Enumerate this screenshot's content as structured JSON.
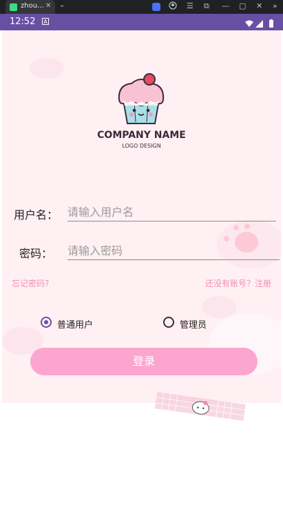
{
  "host_window": {
    "tab_title": "zhou…",
    "tab_close": "✕",
    "new_tab_chevron": "⌄",
    "controls": [
      "☰",
      "⧉",
      "—",
      "▢",
      "✕",
      "»"
    ]
  },
  "status_bar": {
    "time": "12:52",
    "notif_letter": "A",
    "color": "#6750a4"
  },
  "app": {
    "logo": {
      "company": "COMPANY NAME",
      "subtitle": "LOGO DESIGN"
    },
    "form": {
      "username_label": "用户名：",
      "username_placeholder": "请输入用户名",
      "password_label": "密码：",
      "password_placeholder": "请输入密码"
    },
    "links": {
      "forgot": "忘记密码?",
      "register": "还没有账号？注册"
    },
    "roles": [
      {
        "label": "普通用户",
        "selected": true
      },
      {
        "label": "管理员",
        "selected": false
      }
    ],
    "login_button": "登录",
    "colors": {
      "accent": "#6750a4",
      "pink_button": "#fca6cf",
      "link": "#f38db3",
      "background": "#fff0f3"
    }
  }
}
